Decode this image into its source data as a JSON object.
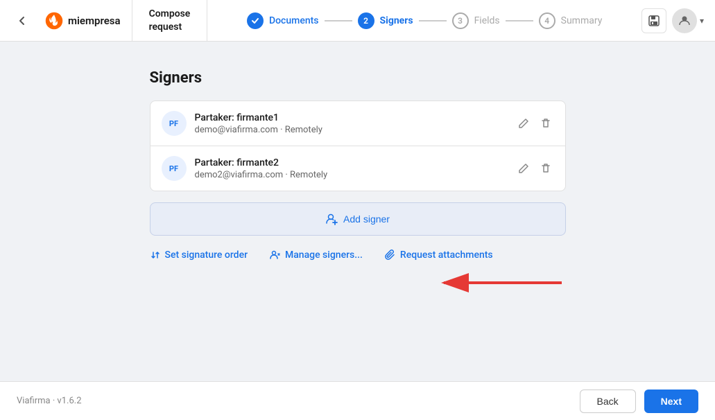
{
  "header": {
    "back_icon": "‹",
    "logo_text": "miempresa",
    "compose_title": "Compose",
    "compose_subtitle": "request",
    "stepper": [
      {
        "id": "documents",
        "number": "",
        "label": "Documents",
        "state": "done",
        "check": "✓"
      },
      {
        "id": "signers",
        "number": "2",
        "label": "Signers",
        "state": "active"
      },
      {
        "id": "fields",
        "number": "3",
        "label": "Fields",
        "state": "inactive"
      },
      {
        "id": "summary",
        "number": "4",
        "label": "Summary",
        "state": "inactive"
      }
    ],
    "save_icon": "💾",
    "avatar_icon": "👤",
    "chevron_icon": "▾"
  },
  "page": {
    "title": "Signers"
  },
  "signers": [
    {
      "initials": "PF",
      "name": "Partaker: firmante1",
      "email": "demo@viafirma.com",
      "mode": "Remotely"
    },
    {
      "initials": "PF",
      "name": "Partaker: firmante2",
      "email": "demo2@viafirma.com",
      "mode": "Remotely"
    }
  ],
  "add_signer_label": "Add signer",
  "action_links": [
    {
      "id": "set-signature-order",
      "label": "Set signature order",
      "icon": "↕"
    },
    {
      "id": "manage-signers",
      "label": "Manage signers...",
      "icon": "👥"
    },
    {
      "id": "request-attachments",
      "label": "Request attachments",
      "icon": "📎"
    }
  ],
  "footer": {
    "version_text": "Viafirma · v1.6.2",
    "back_label": "Back",
    "next_label": "Next"
  }
}
